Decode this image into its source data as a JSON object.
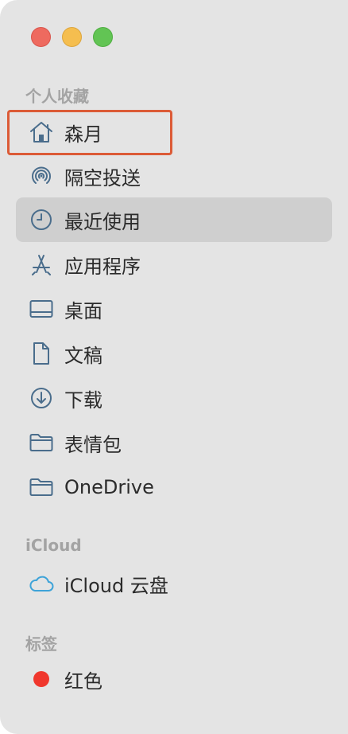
{
  "window": {
    "controls": [
      "close",
      "minimize",
      "zoom"
    ]
  },
  "sections": {
    "favorites": {
      "header": "个人收藏",
      "items": [
        {
          "label": "森月",
          "icon": "home-icon"
        },
        {
          "label": "隔空投送",
          "icon": "airdrop-icon"
        },
        {
          "label": "最近使用",
          "icon": "clock-icon",
          "selected": true
        },
        {
          "label": "应用程序",
          "icon": "applications-icon"
        },
        {
          "label": "桌面",
          "icon": "desktop-icon"
        },
        {
          "label": "文稿",
          "icon": "document-icon"
        },
        {
          "label": "下载",
          "icon": "download-icon"
        },
        {
          "label": "表情包",
          "icon": "folder-icon"
        },
        {
          "label": "OneDrive",
          "icon": "folder-icon"
        }
      ]
    },
    "icloud": {
      "header": "iCloud",
      "items": [
        {
          "label": "iCloud 云盘",
          "icon": "cloud-icon"
        }
      ]
    },
    "tags": {
      "header": "标签",
      "items": [
        {
          "label": "红色",
          "icon": "red-tag-dot",
          "color": "#f0372d"
        }
      ]
    }
  },
  "colors": {
    "icon": "#4a6d8c",
    "selection": "#cfcfcf",
    "focus_ring": "#dc5b37",
    "sidebar_bg": "#e4e4e4"
  }
}
